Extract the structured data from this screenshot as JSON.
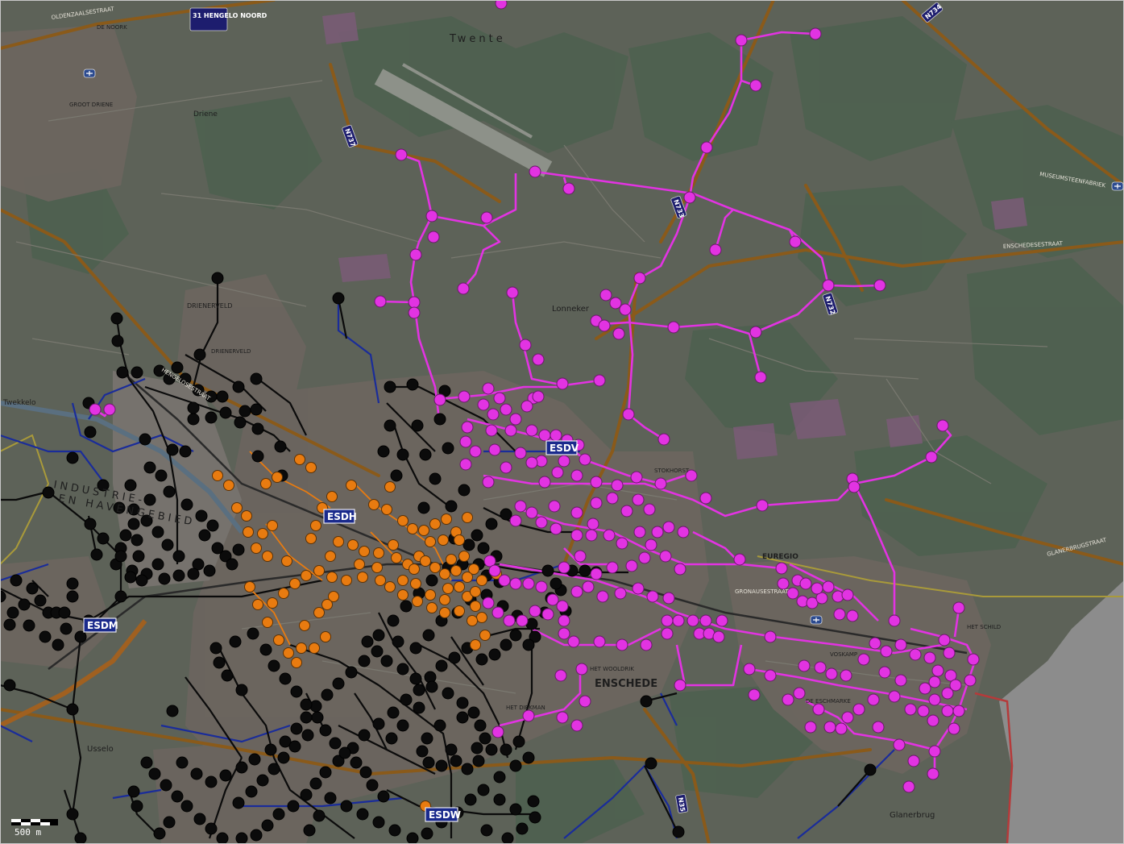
{
  "map": {
    "places": [
      {
        "text": "Twente",
        "size": 13,
        "spacing": 4
      },
      {
        "text": "Lonneker",
        "size": 10,
        "spacing": 0
      },
      {
        "text": "ENSCHEDE",
        "size": 13,
        "spacing": 0
      },
      {
        "text": "INDUSTRIE-",
        "size": 13,
        "spacing": 4
      },
      {
        "text": "EN HAVENGEBIED",
        "size": 13,
        "spacing": 4
      },
      {
        "text": "Usselo",
        "size": 10,
        "spacing": 0
      },
      {
        "text": "Glanerbrug",
        "size": 10,
        "spacing": 0
      },
      {
        "text": "Twekkelo",
        "size": 9,
        "spacing": 0
      },
      {
        "text": "Driene",
        "size": 9,
        "spacing": 0
      },
      {
        "text": "DRIENERVELD",
        "size": 8,
        "spacing": 0
      },
      {
        "text": "EUREGIO",
        "size": 9,
        "spacing": 0
      },
      {
        "text": "HET DIEKMAN",
        "size": 7,
        "spacing": 0
      },
      {
        "text": "HET WOOLDRIK",
        "size": 7,
        "spacing": 0
      },
      {
        "text": "DE ESCHMARKE",
        "size": 7,
        "spacing": 0
      },
      {
        "text": "VOSKAMP",
        "size": 7,
        "spacing": 0
      },
      {
        "text": "HET SCHILD",
        "size": 7,
        "spacing": 0
      },
      {
        "text": "GROOT DRIENE",
        "size": 7,
        "spacing": 0
      },
      {
        "text": "DE NOORK",
        "size": 7,
        "spacing": 0
      },
      {
        "text": "STOKHORST",
        "size": 7,
        "spacing": 0
      },
      {
        "text": "DRIENERVELD",
        "size": 7,
        "spacing": 0
      }
    ],
    "streets": [
      {
        "text": "HENGELOSESTRAAT"
      },
      {
        "text": "ENSCHEDESESTRAAT"
      },
      {
        "text": "OLDENZAALSESTRAAT"
      },
      {
        "text": "GRONAUSESTRAAT"
      },
      {
        "text": "GLANERBRUGSTRAAT"
      },
      {
        "text": "MUSEUMSTEENFABRIEK"
      }
    ],
    "stations": [
      {
        "label": "ESDV"
      },
      {
        "label": "ESDH"
      },
      {
        "label": "ESDM"
      },
      {
        "label": "ESDW"
      }
    ],
    "route_shields": [
      {
        "label": "N737"
      },
      {
        "label": "N732"
      },
      {
        "label": "N733"
      },
      {
        "label": "N734"
      },
      {
        "label": "N35"
      },
      {
        "label": "31 HENGELO NOORD"
      }
    ],
    "scale_bar": {
      "label": "500 m"
    },
    "colors": {
      "magenta_network": "#e233e2",
      "orange_network": "#e87b10",
      "black_network": "#0b0b0b",
      "blue_network": "#1a2c9a",
      "base_land": "#5a5f55",
      "urban": "#6a645e",
      "forest": "#4f6150",
      "major_road": "#8a5a1a",
      "water_grey": "#8c8c8c"
    }
  }
}
